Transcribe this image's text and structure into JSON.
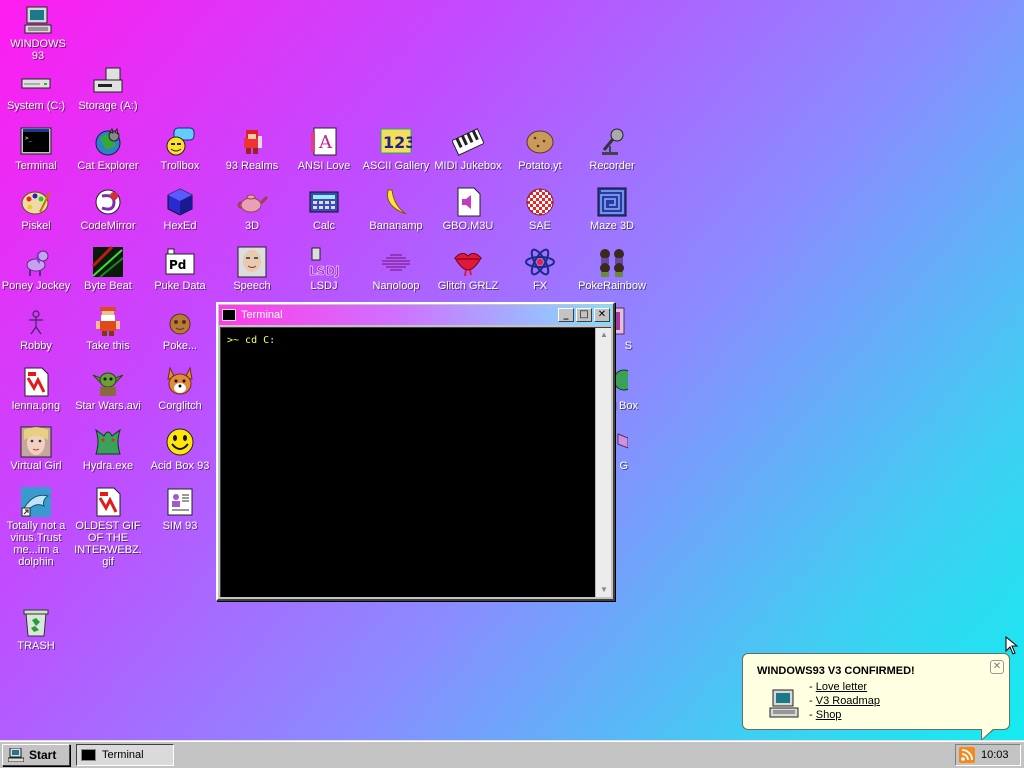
{
  "desktop": {
    "icons": [
      {
        "label": "WINDOWS 93",
        "icon": "computer-icon"
      },
      {
        "label": "System (C:)",
        "icon": "hard-drive-icon"
      },
      {
        "label": "Storage (A:)",
        "icon": "floppy-drive-icon"
      },
      {
        "label": "Terminal",
        "icon": "terminal-icon"
      },
      {
        "label": "Cat Explorer",
        "icon": "cat-explorer-icon"
      },
      {
        "label": "Trollbox",
        "icon": "trollbox-icon"
      },
      {
        "label": "93 Realms",
        "icon": "realms-icon"
      },
      {
        "label": "ANSI Love",
        "icon": "ansi-love-icon"
      },
      {
        "label": "ASCII Gallery",
        "icon": "ascii-gallery-icon"
      },
      {
        "label": "MIDI Jukebox",
        "icon": "midi-jukebox-icon"
      },
      {
        "label": "Potato.yt",
        "icon": "potato-icon"
      },
      {
        "label": "Recorder",
        "icon": "microphone-icon"
      },
      {
        "label": "Piskel",
        "icon": "paint-palette-icon"
      },
      {
        "label": "CodeMirror",
        "icon": "codemirror-icon"
      },
      {
        "label": "HexEd",
        "icon": "hex-cube-icon"
      },
      {
        "label": "3D",
        "icon": "teapot-icon"
      },
      {
        "label": "Calc",
        "icon": "calculator-icon"
      },
      {
        "label": "Bananamp",
        "icon": "banana-icon"
      },
      {
        "label": "GBO.M3U",
        "icon": "audio-file-icon"
      },
      {
        "label": "SAE",
        "icon": "checkered-ball-icon"
      },
      {
        "label": "Maze 3D",
        "icon": "maze-icon"
      },
      {
        "label": "Poney Jockey",
        "icon": "pony-icon"
      },
      {
        "label": "Byte Beat",
        "icon": "byte-beat-icon"
      },
      {
        "label": "Puke Data",
        "icon": "pd-icon"
      },
      {
        "label": "Speech",
        "icon": "speech-face-icon"
      },
      {
        "label": "LSDJ",
        "icon": "lsdj-icon"
      },
      {
        "label": "Nanoloop",
        "icon": "nanoloop-icon"
      },
      {
        "label": "Glitch GRLZ",
        "icon": "lips-icon"
      },
      {
        "label": "FX",
        "icon": "atom-icon"
      },
      {
        "label": "PokeRainbow",
        "icon": "pokerainbow-icon"
      },
      {
        "label": "Robby",
        "icon": "stick-figure-icon"
      },
      {
        "label": "Take this",
        "icon": "pixel-man-icon"
      },
      {
        "label": "Poke...",
        "icon": "poke-icon"
      },
      {
        "label": "lenna.png",
        "icon": "image-file-icon"
      },
      {
        "label": "Star Wars.avi",
        "icon": "yoda-icon"
      },
      {
        "label": "Corglitch",
        "icon": "corgi-icon"
      },
      {
        "label": "Virtual Girl",
        "icon": "face-icon"
      },
      {
        "label": "Hydra.exe",
        "icon": "hydra-icon"
      },
      {
        "label": "Acid Box 93",
        "icon": "smiley-icon"
      },
      {
        "label": "Totally not a virus.Trust me...im a dolphin",
        "icon": "dolphin-icon"
      },
      {
        "label": "OLDEST GIF OF THE INTERWEBZ.gif",
        "icon": "gif-file-icon"
      },
      {
        "label": "SIM 93",
        "icon": "sim-icon"
      },
      {
        "label": "TRASH",
        "icon": "trash-icon"
      },
      {
        "label": "S",
        "icon": "partial-icon"
      },
      {
        "label": "ded Box",
        "icon": "partial-icon"
      },
      {
        "label": "G",
        "icon": "partial-icon"
      }
    ]
  },
  "terminal": {
    "title": "Terminal",
    "prompt_line": ">~ cd C:",
    "buttons": {
      "minimize": "_",
      "maximize": "□",
      "close": "✕"
    }
  },
  "notification": {
    "title": "WINDOWS93 V3 CONFIRMED!",
    "close": "✕",
    "links": [
      {
        "prefix": "- ",
        "label": "Love letter"
      },
      {
        "prefix": "- ",
        "label": "V3 Roadmap"
      },
      {
        "prefix": "- ",
        "label": "Shop"
      }
    ]
  },
  "taskbar": {
    "start_label": "Start",
    "items": [
      {
        "label": "Terminal"
      }
    ],
    "clock": "10:03"
  },
  "colors": {
    "gradient_start": "#ff1cf0",
    "gradient_end": "#10eef0",
    "window_face": "#c3c3c3",
    "terminal_bg": "#000000",
    "terminal_text": "#ffff60",
    "notification_bg": "#ffffe1"
  }
}
